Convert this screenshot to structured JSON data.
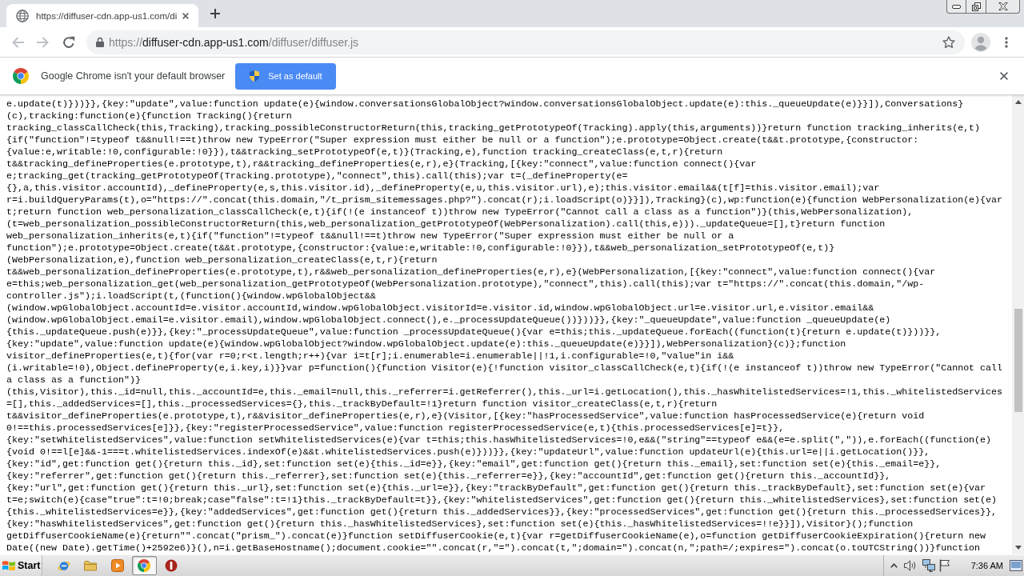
{
  "tab_strip": {
    "tabs": [
      {
        "title": "https://diffuser-cdn.app-us1.com/di",
        "selected": true
      }
    ]
  },
  "toolbar": {
    "nav_buttons": [
      {
        "kind": "back",
        "disabled": true
      },
      {
        "kind": "forward",
        "disabled": true
      },
      {
        "kind": "reload",
        "disabled": false
      }
    ],
    "address": {
      "scheme": "https://",
      "host": "diffuser-cdn.app-us1.com",
      "path": "/diffuser/diffuser.js"
    }
  },
  "infobar": {
    "message": "Google Chrome isn't your default browser",
    "button": "Set as default"
  },
  "source": {
    "lines": [
      "e.update(t)}))}},{key:\"update\",value:function update(e){window.conversationsGlobalObject?window.conversationsGlobalObject.update(e):this._queueUpdate(e)}}]),Conversations}",
      "(c),tracking:function(e){function Tracking(){return",
      "tracking_classCallCheck(this,Tracking),tracking_possibleConstructorReturn(this,tracking_getPrototypeOf(Tracking).apply(this,arguments))}return function tracking_inherits(e,t)",
      "{if(\"function\"!=typeof t&&null!==t)throw new TypeError(\"Super expression must either be null or a function\");e.prototype=Object.create(t&&t.prototype,{constructor:",
      "{value:e,writable:!0,configurable:!0}}),t&&tracking_setPrototypeOf(e,t)}(Tracking,e),function tracking_createClass(e,t,r){return",
      "t&&tracking_defineProperties(e.prototype,t),r&&tracking_defineProperties(e,r),e}(Tracking,[{key:\"connect\",value:function connect(){var",
      "e;tracking_get(tracking_getPrototypeOf(Tracking.prototype),\"connect\",this).call(this);var t=(_defineProperty(e=",
      "{},a,this.visitor.accountId),_defineProperty(e,s,this.visitor.id),_defineProperty(e,u,this.visitor.url),e);this.visitor.email&&(t[f]=this.visitor.email);var",
      "r=i.buildQueryParams(t),o=\"https://\".concat(this.domain,\"/t_prism_sitemessages.php?\").concat(r);i.loadScript(o)}}]),Tracking}(c),wp:function(e){function WebPersonalization(e){var",
      "t;return function web_personalization_classCallCheck(e,t){if(!(e instanceof t))throw new TypeError(\"Cannot call a class as a function\")}(this,WebPersonalization),",
      "(t=web_personalization_possibleConstructorReturn(this,web_personalization_getPrototypeOf(WebPersonalization).call(this,e)))._updateQueue=[],t}return function",
      "web_personalization_inherits(e,t){if(\"function\"!=typeof t&&null!==t)throw new TypeError(\"Super expression must either be null or a",
      "function\");e.prototype=Object.create(t&&t.prototype,{constructor:{value:e,writable:!0,configurable:!0}}),t&&web_personalization_setPrototypeOf(e,t)}",
      "(WebPersonalization,e),function web_personalization_createClass(e,t,r){return",
      "t&&web_personalization_defineProperties(e.prototype,t),r&&web_personalization_defineProperties(e,r),e}(WebPersonalization,[{key:\"connect\",value:function connect(){var",
      "e=this;web_personalization_get(web_personalization_getPrototypeOf(WebPersonalization.prototype),\"connect\",this).call(this);var t=\"https://\".concat(this.domain,\"/wp-",
      "controller.js\");i.loadScript(t,(function(){window.wpGlobalObject&&",
      "(window.wpGlobalObject.accountId=e.visitor.accountId,window.wpGlobalObject.visitorId=e.visitor.id,window.wpGlobalObject.url=e.visitor.url,e.visitor.email&&",
      "(window.wpGlobalObject.email=e.visitor.email),window.wpGlobalObject.connect(),e._processUpdateQueue())}))}},{key:\"_queueUpdate\",value:function _queueUpdate(e)",
      "{this._updateQueue.push(e)}},{key:\"_processUpdateQueue\",value:function _processUpdateQueue(){var e=this;this._updateQueue.forEach((function(t){return e.update(t)}))}},",
      "{key:\"update\",value:function update(e){window.wpGlobalObject?window.wpGlobalObject.update(e):this._queueUpdate(e)}}]),WebPersonalization}(c)};function",
      "visitor_defineProperties(e,t){for(var r=0;r<t.length;r++){var i=t[r];i.enumerable=i.enumerable||!1,i.configurable=!0,\"value\"in i&&",
      "(i.writable=!0),Object.defineProperty(e,i.key,i)}}var p=function(){function Visitor(e){!function visitor_classCallCheck(e,t){if(!(e instanceof t))throw new TypeError(\"Cannot call",
      "a class as a function\")}",
      "(this,Visitor),this._id=null,this._accountId=e,this._email=null,this._referrer=i.getReferrer(),this._url=i.getLocation(),this._hasWhitelistedServices=!1,this._whitelistedServices",
      "=[],this._addedServices=[],this._processedServices={},this._trackByDefault=!1}return function visitor_createClass(e,t,r){return",
      "t&&visitor_defineProperties(e.prototype,t),r&&visitor_defineProperties(e,r),e}(Visitor,[{key:\"hasProcessedService\",value:function hasProcessedService(e){return void",
      "0!==this.processedServices[e]}},{key:\"registerProcessedService\",value:function registerProcessedService(e,t){this.processedServices[e]=t}},",
      "{key:\"setWhitelistedServices\",value:function setWhitelistedServices(e){var t=this;this.hasWhitelistedServices=!0,e&&(\"string\"==typeof e&&(e=e.split(\",\")),e.forEach((function(e)",
      "{void 0!==l[e]&&-1===t.whitelistedServices.indexOf(e)&&t.whitelistedServices.push(e)}))}},{key:\"updateUrl\",value:function updateUrl(e){this.url=e||i.getLocation()}},",
      "{key:\"id\",get:function get(){return this._id},set:function set(e){this._id=e}},{key:\"email\",get:function get(){return this._email},set:function set(e){this._email=e}},",
      "{key:\"referrer\",get:function get(){return this._referrer},set:function set(e){this._referrer=e}},{key:\"accountId\",get:function get(){return this._accountId}},",
      "{key:\"url\",get:function get(){return this._url},set:function set(e){this._url=e}},{key:\"trackByDefault\",get:function get(){return this._trackByDefault},set:function set(e){var",
      "t=e;switch(e){case\"true\":t=!0;break;case\"false\":t=!1}this._trackByDefault=t}},{key:\"whitelistedServices\",get:function get(){return this._whitelistedServices},set:function set(e)",
      "{this._whitelistedServices=e}},{key:\"addedServices\",get:function get(){return this._addedServices}},{key:\"processedServices\",get:function get(){return this._processedServices}},",
      "{key:\"hasWhitelistedServices\",get:function get(){return this._hasWhitelistedServices},set:function set(e){this._hasWhitelistedServices=!!e}}]),Visitor}();function",
      "getDiffuserCookieName(e){return\"\".concat(\"prism_\").concat(e)}function setDiffuserCookie(e,t){var r=getDiffuserCookieName(e),o=function getDiffuserCookieExpiration(){return new",
      "Date((new Date).getTime()+2592e6)}(),n=i.getBaseHostname();document.cookie=\"\".concat(r,\"=\").concat(t,\";domain=\").concat(n,\";path=/;expires=\").concat(o.toUTCString())}function"
    ]
  },
  "taskbar": {
    "start": "Start",
    "apps": [
      {
        "kind": "ie",
        "selected": false
      },
      {
        "kind": "folder",
        "selected": false
      },
      {
        "kind": "media",
        "selected": false
      },
      {
        "kind": "chrome",
        "selected": true
      },
      {
        "kind": "alert",
        "selected": false
      }
    ],
    "clock": "7:36 AM"
  }
}
